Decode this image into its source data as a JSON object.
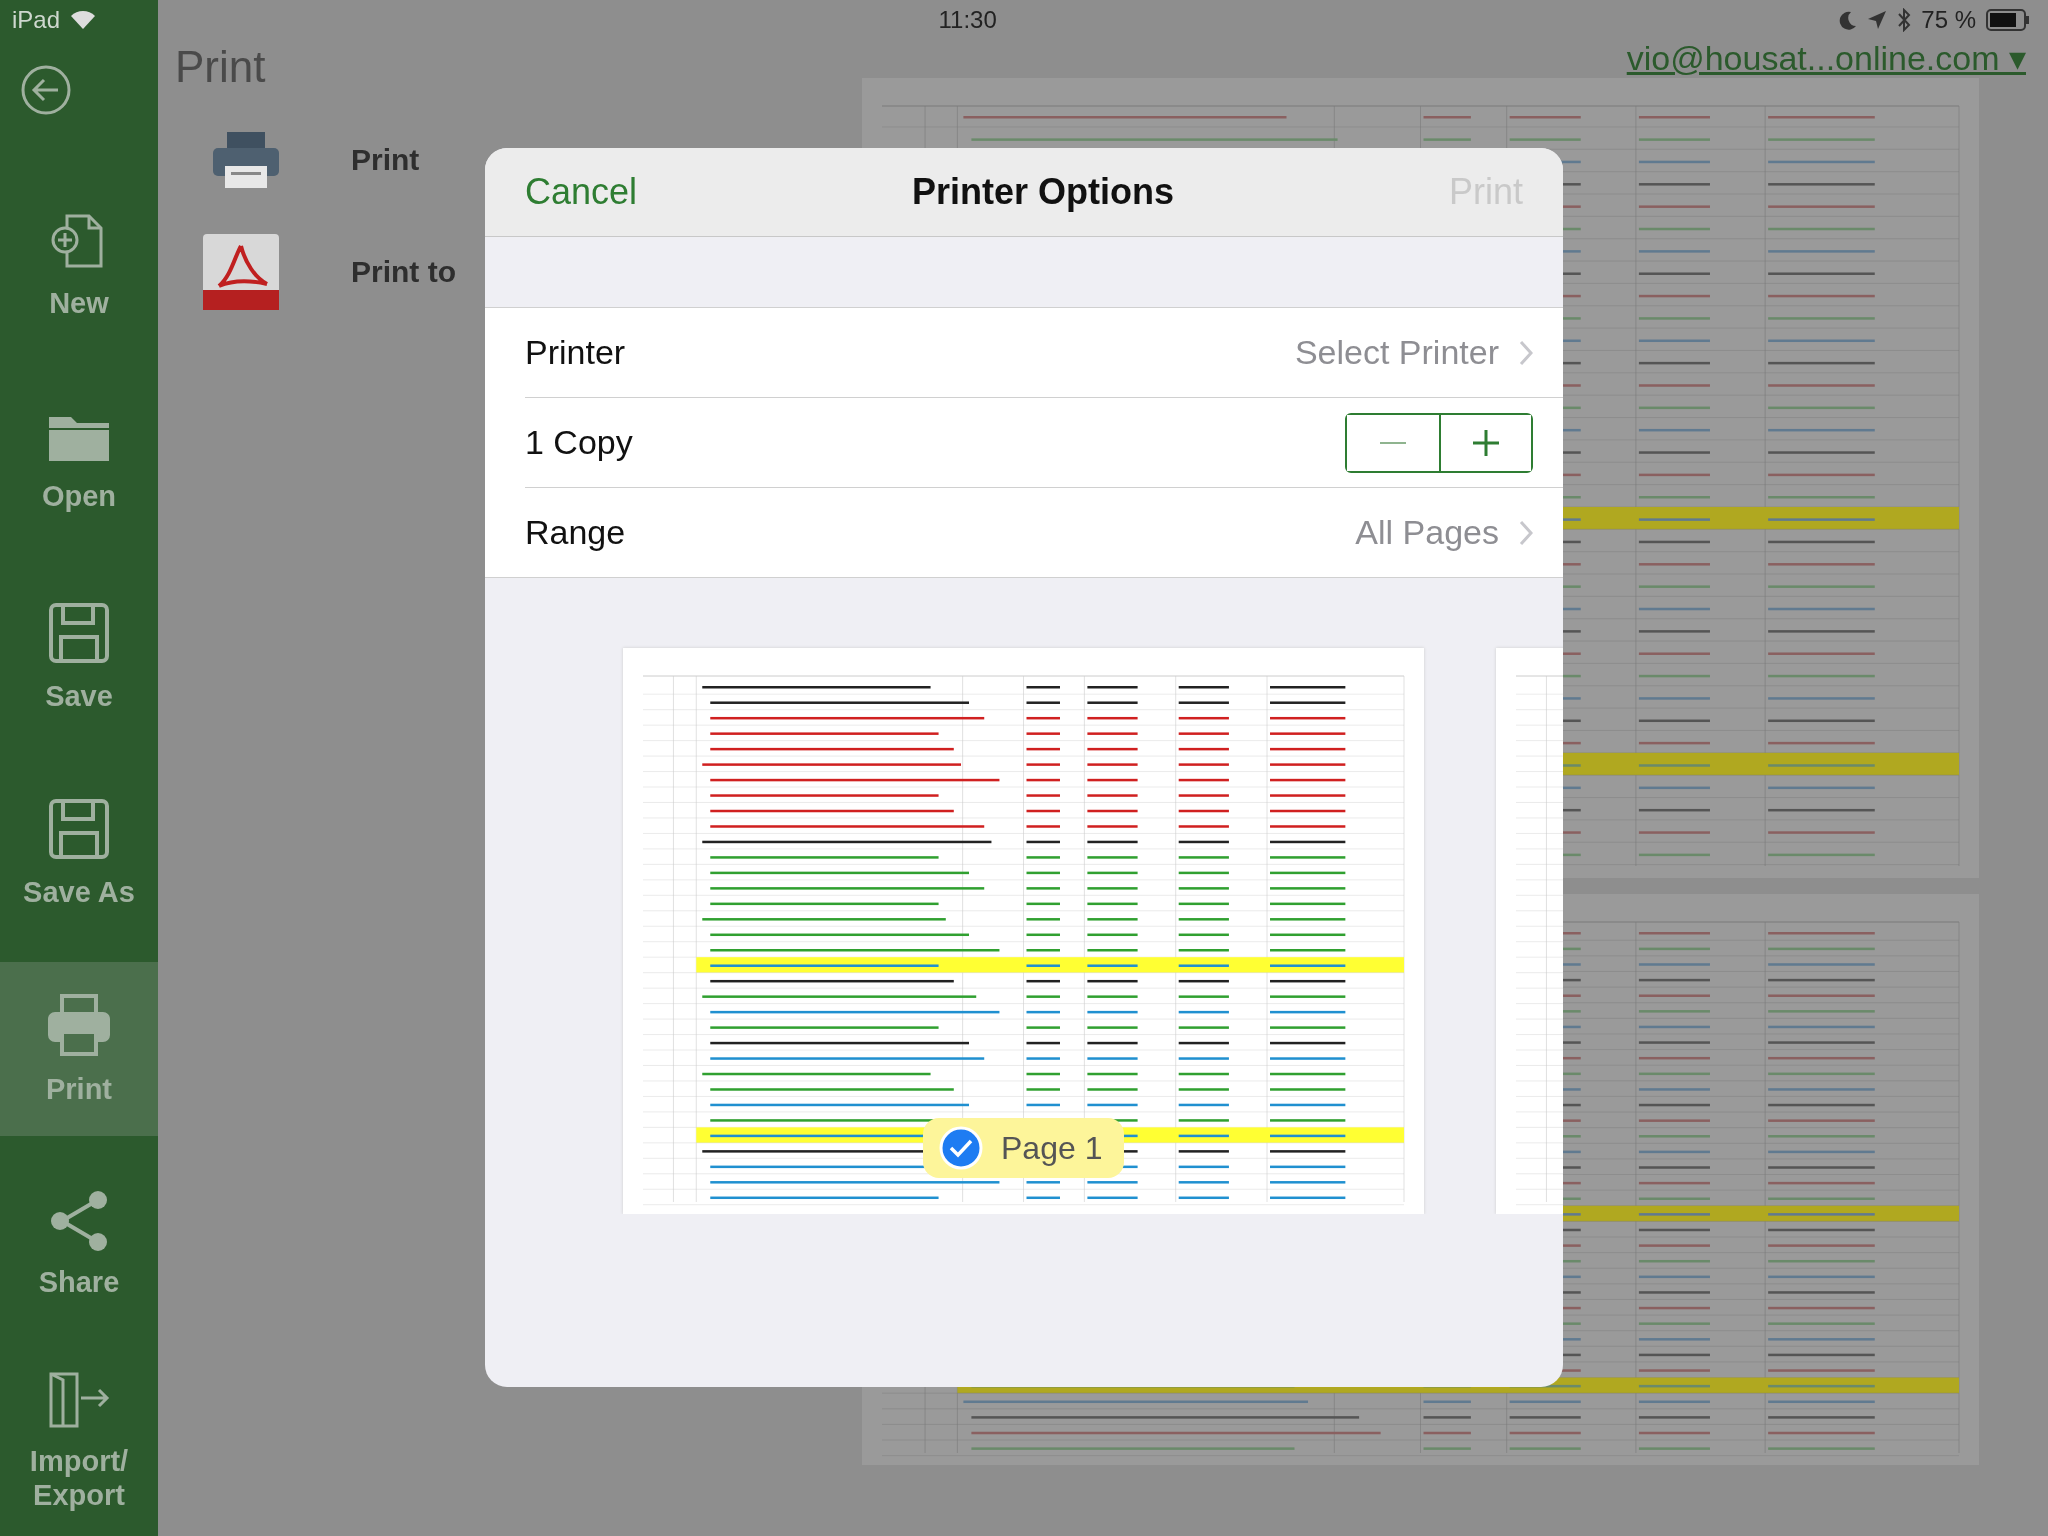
{
  "status_bar": {
    "device": "iPad",
    "time": "11:30",
    "battery": "75 %"
  },
  "sidebar": {
    "items": [
      {
        "label": "New",
        "selected": false
      },
      {
        "label": "Open",
        "selected": false
      },
      {
        "label": "Save",
        "selected": false
      },
      {
        "label": "Save As",
        "selected": false
      },
      {
        "label": "Print",
        "selected": true
      },
      {
        "label": "Share",
        "selected": false
      },
      {
        "label": "Import/ Export",
        "selected": false
      }
    ]
  },
  "page_title": "Print",
  "account": "vio@housat...online.com ▾",
  "print_options": [
    {
      "kind": "printer",
      "label": "Print"
    },
    {
      "kind": "pdf",
      "label": "Print to"
    }
  ],
  "dialog": {
    "title": "Printer Options",
    "cancel": "Cancel",
    "confirm": {
      "label": "Print",
      "disabled": true
    },
    "rows": [
      {
        "kind": "link",
        "label": "Printer",
        "value": "Select Printer"
      },
      {
        "kind": "stepper",
        "label": "1 Copy"
      },
      {
        "kind": "link",
        "label": "Range",
        "value": "All Pages"
      }
    ],
    "pages": [
      {
        "label": "Page 1",
        "selected": true
      }
    ]
  }
}
